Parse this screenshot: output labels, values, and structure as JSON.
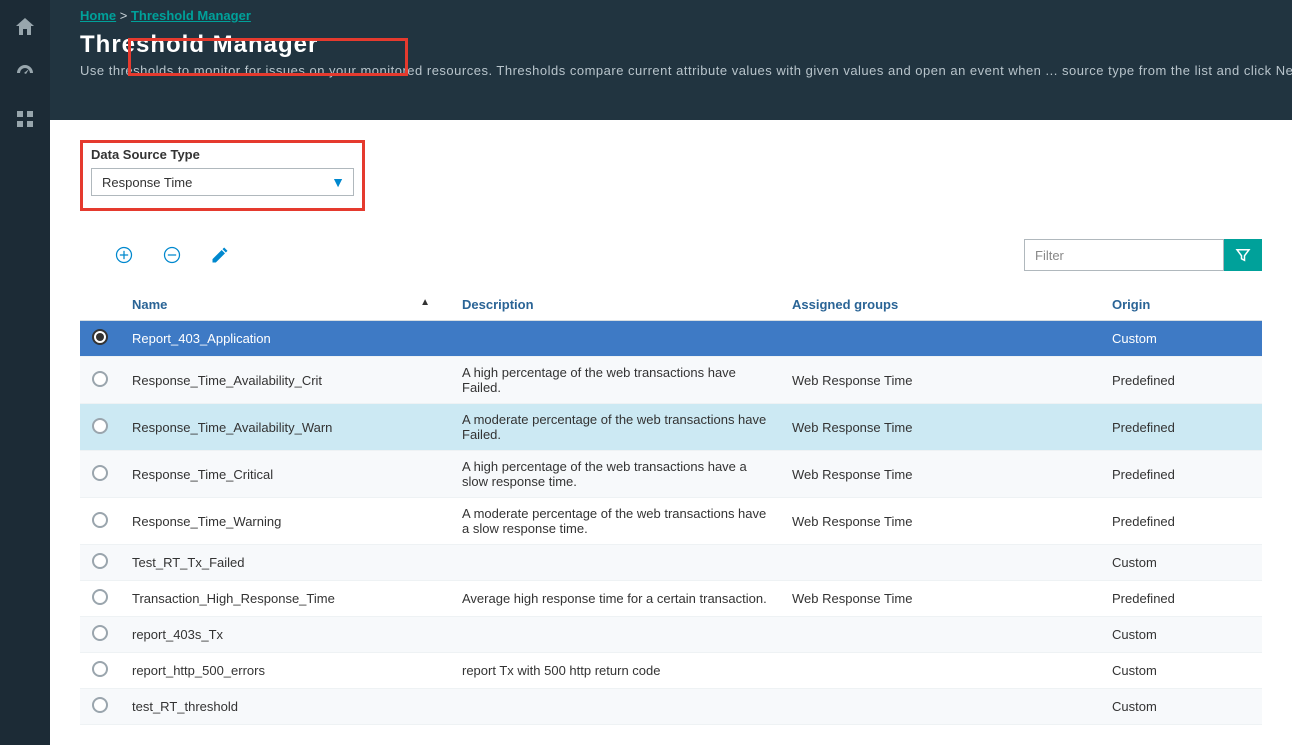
{
  "breadcrumb": {
    "home": "Home",
    "current": "Threshold Manager"
  },
  "title": "Threshold Manager",
  "subtitle": "Use thresholds to monitor for issues on your monitored resources. Thresholds compare current attribute values with given values and open an event when ... source type from the list and click New. To edit or delete a threshold, select the data source type that it was written for, select the radio button, and click E",
  "dst": {
    "label": "Data Source Type",
    "value": "Response Time"
  },
  "toolbar": {
    "filter_placeholder": "Filter"
  },
  "columns": {
    "name": "Name",
    "description": "Description",
    "groups": "Assigned groups",
    "origin": "Origin"
  },
  "rows": [
    {
      "name": "Report_403_Application",
      "description": "",
      "groups": "",
      "origin": "Custom",
      "selected": true
    },
    {
      "name": "Response_Time_Availability_Crit",
      "description": "A high percentage of the web transactions have Failed.",
      "groups": "Web Response Time",
      "origin": "Predefined"
    },
    {
      "name": "Response_Time_Availability_Warn",
      "description": "A moderate percentage of the web transactions have Failed.",
      "groups": "Web Response Time",
      "origin": "Predefined",
      "highlight": true
    },
    {
      "name": "Response_Time_Critical",
      "description": "A high percentage of the web transactions have a slow response time.",
      "groups": "Web Response Time",
      "origin": "Predefined"
    },
    {
      "name": "Response_Time_Warning",
      "description": "A moderate percentage of the web transactions have a slow response time.",
      "groups": "Web Response Time",
      "origin": "Predefined"
    },
    {
      "name": "Test_RT_Tx_Failed",
      "description": "",
      "groups": "",
      "origin": "Custom"
    },
    {
      "name": "Transaction_High_Response_Time",
      "description": "Average high response time for a certain transaction.",
      "groups": "Web Response Time",
      "origin": "Predefined"
    },
    {
      "name": "report_403s_Tx",
      "description": "",
      "groups": "",
      "origin": "Custom"
    },
    {
      "name": "report_http_500_errors",
      "description": "report Tx with 500 http return code",
      "groups": "",
      "origin": "Custom"
    },
    {
      "name": "test_RT_threshold",
      "description": "",
      "groups": "",
      "origin": "Custom"
    }
  ]
}
